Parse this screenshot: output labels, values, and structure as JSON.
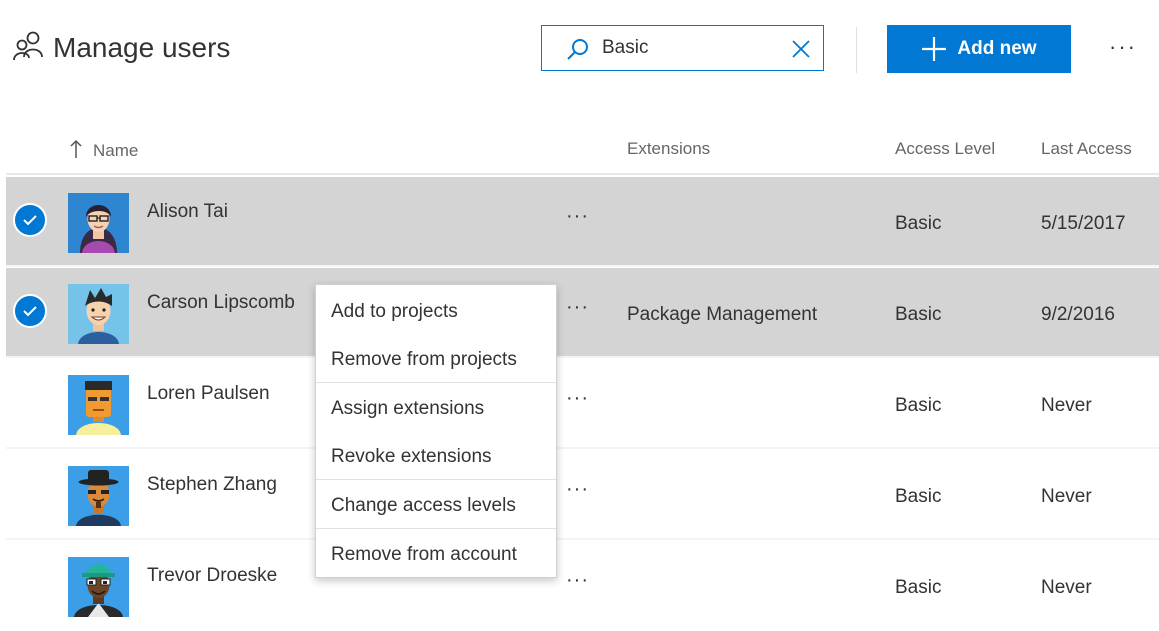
{
  "header": {
    "title": "Manage users",
    "search_value": "Basic",
    "add_new_label": "Add new",
    "more_label": "···",
    "users_icon": "people-icon",
    "accent_color": "#0078d4"
  },
  "columns": {
    "name": "Name",
    "extensions": "Extensions",
    "access_level": "Access Level",
    "last_access": "Last Access"
  },
  "rows": [
    {
      "name": "Alison Tai",
      "extensions": "",
      "access": "Basic",
      "last": "5/15/2017",
      "selected": true
    },
    {
      "name": "Carson Lipscomb",
      "extensions": "Package Management",
      "access": "Basic",
      "last": "9/2/2016",
      "selected": true
    },
    {
      "name": "Loren Paulsen",
      "extensions": "",
      "access": "Basic",
      "last": "Never",
      "selected": false
    },
    {
      "name": "Stephen Zhang",
      "extensions": "",
      "access": "Basic",
      "last": "Never",
      "selected": false
    },
    {
      "name": "Trevor Droeske",
      "extensions": "",
      "access": "Basic",
      "last": "Never",
      "selected": false
    }
  ],
  "row_more_label": "···",
  "context_menu": {
    "items": [
      "Add to projects",
      "Remove from projects",
      "Assign extensions",
      "Revoke extensions",
      "Change access levels",
      "Remove from account"
    ]
  }
}
